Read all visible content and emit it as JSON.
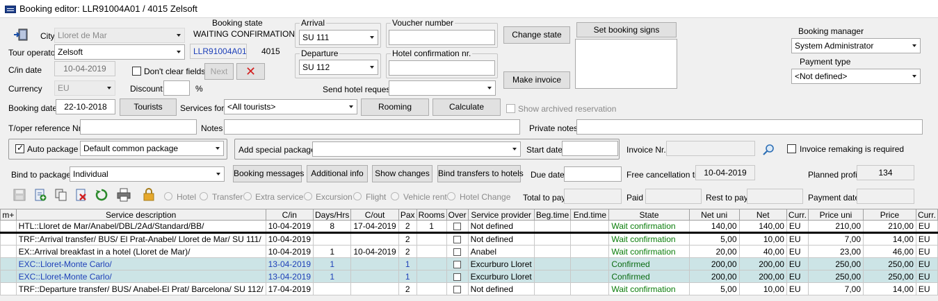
{
  "window": {
    "title": "Booking editor: LLR91004A01 / 4015  Zelsoft"
  },
  "form": {
    "city_label": "City",
    "city_value": "Lloret de Mar",
    "booking_state_label": "Booking state",
    "booking_state_value": "WAITING CONFIRMATION",
    "tour_operator_label": "Tour operator",
    "tour_operator_value": "Zelsoft",
    "booking_code": "LLR91004A01",
    "booking_number": "4015",
    "checkin_label": "C/in date",
    "checkin_value": "10-04-2019",
    "dont_clear_label": "Don't clear fields",
    "next_label": "Next",
    "currency_label": "Currency",
    "currency_value": "EU",
    "discount_label": "Discount:",
    "discount_value": "",
    "percent_sign": "%",
    "booking_date_label": "Booking date",
    "booking_date_value": "22-10-2018",
    "tourists_label": "Tourists",
    "services_for_label": "Services for:",
    "services_for_value": "<All tourists>",
    "rooming_label": "Rooming",
    "calculate_label": "Calculate",
    "show_archived_label": "Show archived reservation",
    "arrival_label": "Arrival",
    "arrival_value": "SU 111",
    "departure_label": "Departure",
    "departure_value": "SU 112",
    "voucher_label": "Voucher number",
    "voucher_value": "",
    "hotel_conf_label": "Hotel confirmation nr.",
    "hotel_conf_value": "",
    "send_hotel_label": "Send hotel request",
    "send_hotel_value": "",
    "change_state_label": "Change state",
    "make_invoice_label": "Make invoice",
    "set_signs_label": "Set booking signs",
    "signs_value": "",
    "booking_manager_label": "Booking manager",
    "booking_manager_value": "System Administrator",
    "payment_type_label": "Payment type",
    "payment_type_value": "<Not defined>",
    "toper_ref_label": "T/oper reference Nr.",
    "toper_ref_value": "",
    "notes_label": "Notes",
    "notes_value": "",
    "private_notes_label": "Private notes",
    "private_notes_value": "",
    "auto_package_label": "Auto package",
    "auto_package_value": "Default common package",
    "add_special_label": "Add special package",
    "add_special_value": "",
    "start_date_label": "Start date",
    "start_date_value": "",
    "invoice_nr_label": "Invoice Nr.",
    "invoice_nr_value": "",
    "invoice_remaking_label": "Invoice remaking is required",
    "bind_package_label": "Bind to package",
    "bind_package_value": "Individual",
    "booking_messages_label": "Booking messages",
    "additional_info_label": "Additional info",
    "show_changes_label": "Show changes",
    "bind_transfers_label": "Bind transfers to hotels",
    "due_date_label": "Due date",
    "due_date_value": "",
    "free_cancel_label": "Free cancellation till",
    "free_cancel_value": "10-04-2019",
    "planned_profit_label": "Planned profit",
    "planned_profit_value": "134",
    "total_pay_label": "Total to pay",
    "total_pay_value": "",
    "paid_label": "Paid",
    "paid_value": "",
    "rest_pay_label": "Rest to pay",
    "rest_pay_value": "",
    "payment_date_label": "Payment date",
    "payment_date_value": ""
  },
  "service_types": [
    "Hotel",
    "Transfer",
    "Extra service",
    "Excursion",
    "Flight",
    "Vehicle rent",
    "Hotel Change"
  ],
  "toolbar_icons": [
    "save-icon",
    "add-icon",
    "copy-icon",
    "delete-icon",
    "refresh-icon",
    "print-icon",
    "lock-icon"
  ],
  "colors": {
    "confirmed_row": "#cce4e6",
    "state_green": "#0a7d0a",
    "excursion_blue": "#1d3fb8",
    "delete_red": "#d21f1f"
  },
  "grid": {
    "columns": [
      "m+",
      "Service description",
      "C/in",
      "Days/Hrs",
      "C/out",
      "Pax",
      "Rooms",
      "Over",
      "Service provider",
      "Beg.time",
      "End.time",
      "State",
      "Net uni",
      "Net",
      "Curr.",
      "Price uni",
      "Price",
      "Curr."
    ],
    "rows": [
      [
        "",
        "HTL::Lloret de Mar/Anabel/DBL/2Ad/Standard/BB/",
        "10-04-2019",
        "8",
        "17-04-2019",
        "2",
        "1",
        "",
        "Not defined",
        "",
        "",
        "Wait confirmation",
        "140,00",
        "140,00",
        "EU",
        "210,00",
        "210,00",
        "EU"
      ],
      [
        "",
        "TRF::Arrival transfer/ BUS/ El Prat-Anabel/ Lloret de Mar/ SU 111/",
        "10-04-2019",
        "",
        "",
        "2",
        "",
        "",
        "Not defined",
        "",
        "",
        "Wait confirmation",
        "5,00",
        "10,00",
        "EU",
        "7,00",
        "14,00",
        "EU"
      ],
      [
        "",
        "EX::Arrival breakfast in a hotel (Lloret de Mar)/",
        "10-04-2019",
        "1",
        "10-04-2019",
        "2",
        "",
        "",
        "Anabel",
        "",
        "",
        "Wait confirmation",
        "20,00",
        "40,00",
        "EU",
        "23,00",
        "46,00",
        "EU"
      ],
      [
        "",
        "EXC::Lloret-Monte Carlo/",
        "13-04-2019",
        "1",
        "",
        "1",
        "",
        "",
        "Excurburo Lloret",
        "",
        "",
        "Confirmed",
        "200,00",
        "200,00",
        "EU",
        "250,00",
        "250,00",
        "EU"
      ],
      [
        "",
        "EXC::Lloret-Monte Carlo/",
        "13-04-2019",
        "1",
        "",
        "1",
        "",
        "",
        "Excurburo Lloret",
        "",
        "",
        "Confirmed",
        "200,00",
        "200,00",
        "EU",
        "250,00",
        "250,00",
        "EU"
      ],
      [
        "",
        "TRF::Departure transfer/ BUS/ Anabel-El Prat/ Barcelona/ SU 112/",
        "17-04-2019",
        "",
        "",
        "2",
        "",
        "",
        "Not defined",
        "",
        "",
        "Wait confirmation",
        "5,00",
        "10,00",
        "EU",
        "7,00",
        "14,00",
        "EU"
      ]
    ]
  }
}
